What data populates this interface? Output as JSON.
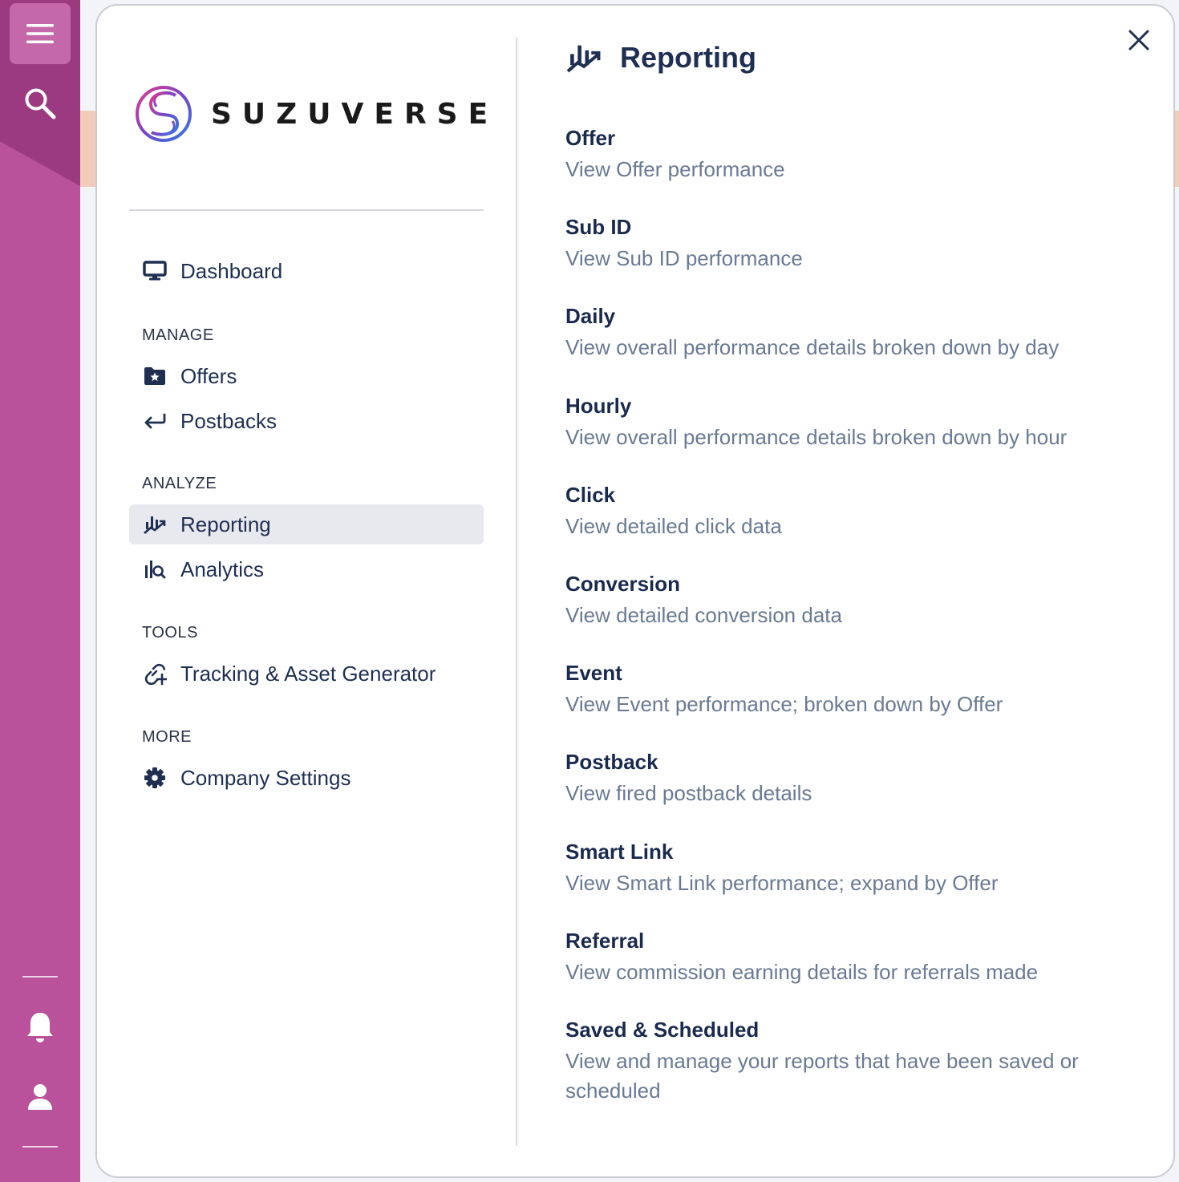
{
  "rail": {
    "menu_icon": "hamburger-icon",
    "search_icon": "search-icon",
    "bell_icon": "bell-icon",
    "user_icon": "user-icon"
  },
  "brand": {
    "name": "SUZUVERSE"
  },
  "nav": {
    "dashboard": "Dashboard",
    "sections": {
      "manage": "MANAGE",
      "analyze": "ANALYZE",
      "tools": "TOOLS",
      "more": "MORE"
    },
    "offers": "Offers",
    "postbacks": "Postbacks",
    "reporting": "Reporting",
    "analytics": "Analytics",
    "tracking": "Tracking & Asset Generator",
    "company_settings": "Company Settings",
    "active_item": "Reporting"
  },
  "reporting": {
    "title": "Reporting",
    "items": [
      {
        "title": "Offer",
        "desc": "View Offer performance"
      },
      {
        "title": "Sub ID",
        "desc": "View Sub ID performance"
      },
      {
        "title": "Daily",
        "desc": "View overall performance details broken down by day"
      },
      {
        "title": "Hourly",
        "desc": "View overall performance details broken down by hour"
      },
      {
        "title": "Click",
        "desc": "View detailed click data"
      },
      {
        "title": "Conversion",
        "desc": "View detailed conversion data"
      },
      {
        "title": "Event",
        "desc": "View Event performance; broken down by Offer"
      },
      {
        "title": "Postback",
        "desc": "View fired postback details"
      },
      {
        "title": "Smart Link",
        "desc": "View Smart Link performance; expand by Offer"
      },
      {
        "title": "Referral",
        "desc": "View commission earning details for referrals made"
      },
      {
        "title": "Saved & Scheduled",
        "desc": "View and manage your reports that have been saved or scheduled"
      }
    ]
  },
  "colors": {
    "rail": "#b9519b",
    "rail_dark": "#9b3a80",
    "primary_text": "#1f2f52",
    "muted_text": "#6a7a93",
    "active_bg": "#e8e9ee"
  }
}
